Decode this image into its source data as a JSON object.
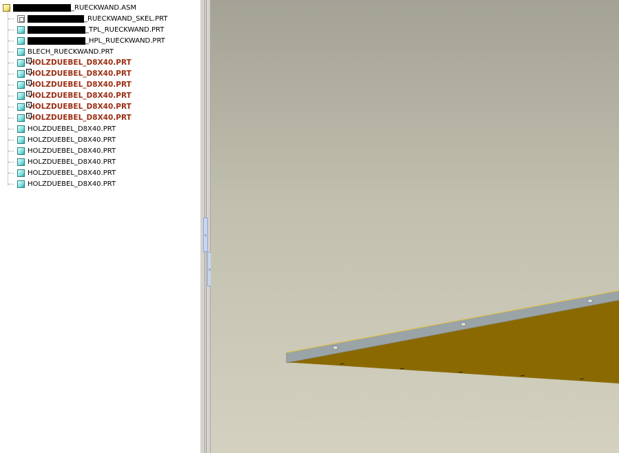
{
  "model_tree": {
    "root_label": "_RUECKWAND.ASM",
    "items": [
      {
        "label": "_RUECKWAND_SKEL.PRT",
        "type": "skeleton",
        "redacted": true,
        "suppressed": false
      },
      {
        "label": "_TPL_RUECKWAND.PRT",
        "type": "part",
        "redacted": true,
        "suppressed": false
      },
      {
        "label": "_HPL_RUECKWAND.PRT",
        "type": "part",
        "redacted": true,
        "suppressed": false
      },
      {
        "label": "BLECH_RUECKWAND.PRT",
        "type": "part",
        "redacted": false,
        "suppressed": false
      },
      {
        "label": "HOLZDUEBEL_D8X40.PRT",
        "type": "part",
        "redacted": false,
        "suppressed": true
      },
      {
        "label": "HOLZDUEBEL_D8X40.PRT",
        "type": "part",
        "redacted": false,
        "suppressed": true
      },
      {
        "label": "HOLZDUEBEL_D8X40.PRT",
        "type": "part",
        "redacted": false,
        "suppressed": true
      },
      {
        "label": "HOLZDUEBEL_D8X40.PRT",
        "type": "part",
        "redacted": false,
        "suppressed": true
      },
      {
        "label": "HOLZDUEBEL_D8X40.PRT",
        "type": "part",
        "redacted": false,
        "suppressed": true
      },
      {
        "label": "HOLZDUEBEL_D8X40.PRT",
        "type": "part",
        "redacted": false,
        "suppressed": true
      },
      {
        "label": "HOLZDUEBEL_D8X40.PRT",
        "type": "part",
        "redacted": false,
        "suppressed": false
      },
      {
        "label": "HOLZDUEBEL_D8X40.PRT",
        "type": "part",
        "redacted": false,
        "suppressed": false
      },
      {
        "label": "HOLZDUEBEL_D8X40.PRT",
        "type": "part",
        "redacted": false,
        "suppressed": false
      },
      {
        "label": "HOLZDUEBEL_D8X40.PRT",
        "type": "part",
        "redacted": false,
        "suppressed": false
      },
      {
        "label": "HOLZDUEBEL_D8X40.PRT",
        "type": "part",
        "redacted": false,
        "suppressed": false
      },
      {
        "label": "HOLZDUEBEL_D8X40.PRT",
        "type": "part",
        "redacted": false,
        "suppressed": false
      }
    ],
    "suppressed_color": "#9b2f14"
  },
  "splitter": {
    "collapse_glyph": "‹",
    "expand_glyph": "›"
  },
  "viewport": {
    "background_top": "#a3a295",
    "background_bottom": "#d4d1c0",
    "panel_color": "#8a6a00",
    "edge_color": "#9aa3a6"
  }
}
